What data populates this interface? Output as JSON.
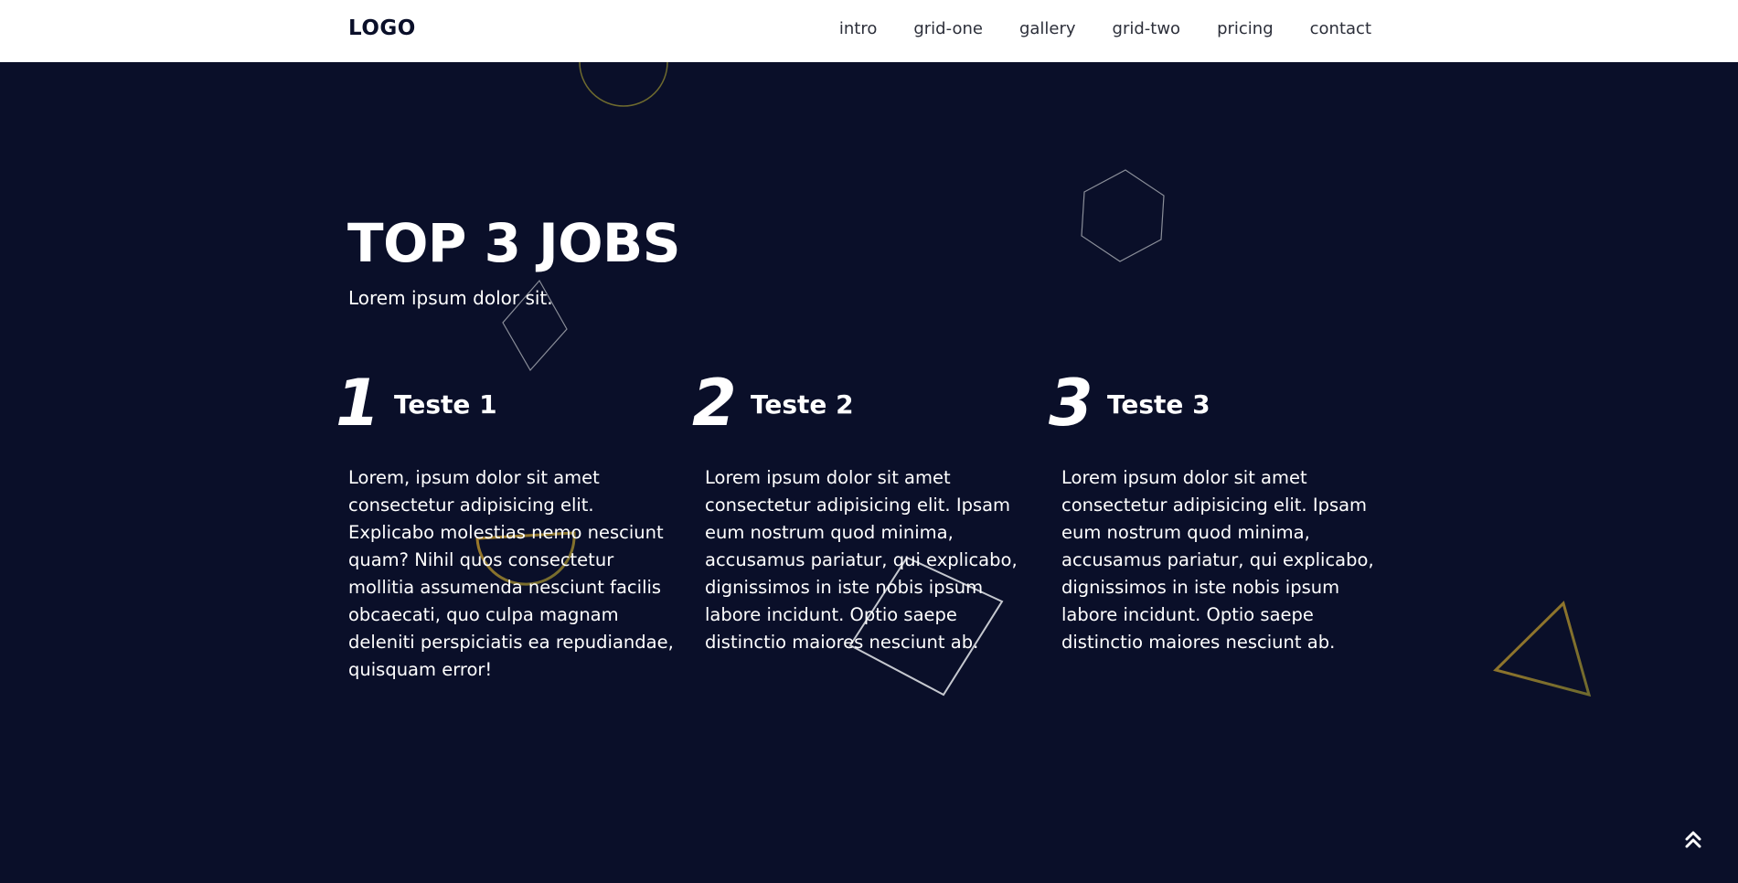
{
  "header": {
    "logo": "LOGO",
    "nav": [
      "intro",
      "grid-one",
      "gallery",
      "grid-two",
      "pricing",
      "contact"
    ]
  },
  "section": {
    "title": "TOP 3 JOBS",
    "subtitle": "Lorem ipsum dolor sit.",
    "jobs": [
      {
        "number": "1",
        "title": "Teste 1",
        "text": "Lorem, ipsum dolor sit amet consectetur adipisicing elit. Explicabo molestias nemo nesciunt quam? Nihil quos consectetur mollitia assumenda nesciunt facilis obcaecati, quo culpa magnam deleniti perspiciatis ea repudiandae, quisquam error!"
      },
      {
        "number": "2",
        "title": "Teste 2",
        "text": "Lorem ipsum dolor sit amet consectetur adipisicing elit. Ipsam eum nostrum quod minima, accusamus pariatur, qui explicabo, dignissimos in iste nobis ipsum labore incidunt. Optio saepe distinctio maiores nesciunt ab."
      },
      {
        "number": "3",
        "title": "Teste 3",
        "text": "Lorem ipsum dolor sit amet consectetur adipisicing elit. Ipsam eum nostrum quod minima, accusamus pariatur, qui explicabo, dignissimos in iste nobis ipsum labore incidunt. Optio saepe distinctio maiores nesciunt ab."
      }
    ]
  },
  "scroll_top_icon": "double-chevron-up-icon",
  "colors": {
    "background": "#0a0f29",
    "header": "#ffffff",
    "text": "#ffffff",
    "accent_gold": "#8a7a2e"
  }
}
